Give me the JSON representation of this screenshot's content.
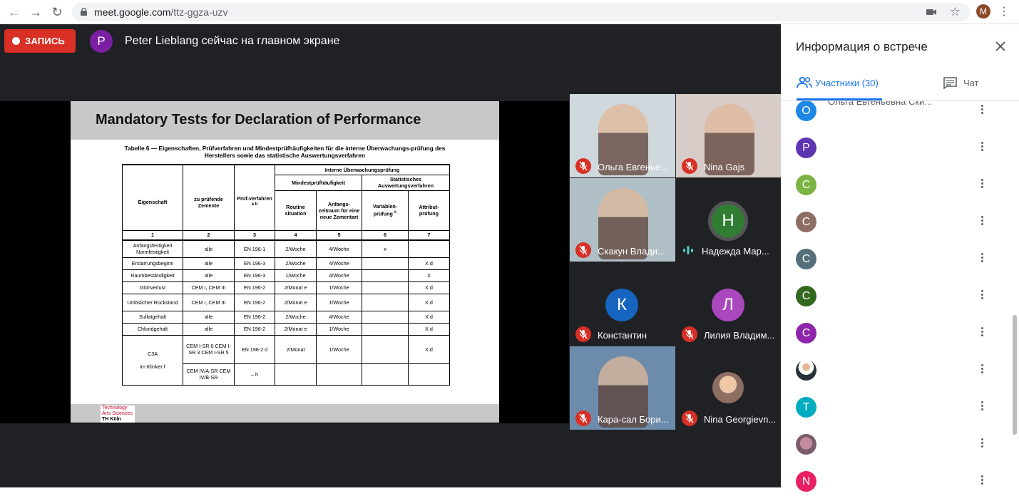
{
  "browser": {
    "url_host": "meet.google.com",
    "url_path": "/ttz-ggza-uzv",
    "profile_initial": "M"
  },
  "stage": {
    "record_label": "ЗАПИСЬ",
    "presenter_initial": "P",
    "presenter_text": "Peter Lieblang сейчас на главном экране"
  },
  "slide": {
    "title": "Mandatory Tests for Declaration of Performance",
    "caption": "Tabelle 6 — Eigenschaften, Prüfverfahren und Mindestprüfhäufigkeiten für die interne Überwachungs-prüfung des Herstellers sowie das statistische Auswertungsverfahren",
    "header_group": "Interne Überwachungsprüfung",
    "header_min": "Mindestprüfhäufigkeit",
    "header_stat": "Statistisches Auswertungsverfahren",
    "col_eigenschaft": "Eigenschaft",
    "col_zemente": "zu prüfende Zemente",
    "col_pruef": "Prüf-verfahren",
    "col_pruef_sup": "a b",
    "col_routine": "Routine situation",
    "col_anfangs": "Anfangs-zeitraum für eine neue Zementart",
    "col_variablen": "Variablen-prüfung",
    "col_variablen_sup": "c",
    "col_attribut": "Attribut-prüfung",
    "col_numbers": [
      "1",
      "2",
      "3",
      "4",
      "5",
      "6",
      "7"
    ],
    "rows": [
      [
        "Anfangsfestigkeit Normfestigkeit",
        "alle",
        "EN 196-1",
        "2/Woche",
        "4/Woche",
        "x",
        ""
      ],
      [
        "Erstarrungsbeginn",
        "alle",
        "EN 196-3",
        "2/Woche",
        "4/Woche",
        "",
        "X d"
      ],
      [
        "Raumbeständigkeit",
        "alle",
        "EN 196-3",
        "1/Woche",
        "4/Woche",
        "",
        "X"
      ],
      [
        "Glühverlust",
        "CEM I, CEM III",
        "EN 196-2",
        "2/Monat e",
        "1/Woche",
        "",
        "X d"
      ],
      [
        "Unlöslicher Rückstand",
        "CEM I, CEM III",
        "EN 196-2",
        "2/Monat e",
        "1/Woche",
        "",
        "X d"
      ],
      [
        "Sulfatgehalt",
        "alle",
        "EN 196-2",
        "2/Woche",
        "4/Woche",
        "",
        "X d"
      ],
      [
        "Chloridgehalt",
        "alle",
        "EN 196-2",
        "2/Monat e",
        "1/Woche",
        "",
        "X d"
      ]
    ],
    "c3a_label": "C3A",
    "c3a_sub": "im Klinker f",
    "c3a_zemente_a": "CEM I-SR 0 CEM I-SR 3 CEM I-SR 5",
    "c3a_pruef_a": "EN 196-2 d",
    "c3a_routine_a": "2/Monat",
    "c3a_anfangs_a": "1/Woche",
    "c3a_attr_a": "X d",
    "c3a_zemente_b": "CEM IV/A-SR CEM IV/B-SR",
    "c3a_pruef_b": "– h",
    "logo_line1": "Technology",
    "logo_line2": "Arts Sciences",
    "logo_line3": "TH Köln"
  },
  "tiles": [
    {
      "name": "Ольга Евгенье...",
      "muted": true
    },
    {
      "name": "Nina Gajs",
      "muted": true
    },
    {
      "name": "Скакун Влади...",
      "muted": true
    },
    {
      "name": "Надежда Мар...",
      "muted": false,
      "initial": "Н",
      "color": "#2e7d32"
    },
    {
      "name": "Константин",
      "muted": true,
      "initial": "К",
      "color": "#1565c0"
    },
    {
      "name": "Лилия Владим...",
      "muted": true,
      "initial": "Л",
      "color": "#ab47bc"
    },
    {
      "name": "Кара-сал Бори...",
      "muted": true
    },
    {
      "name": "Nina Georgievn...",
      "muted": true
    }
  ],
  "sidebar": {
    "title": "Информация о встрече",
    "tab_people": "Участники (30)",
    "tab_chat": "Чат",
    "participants": [
      {
        "initial": "О",
        "color": "#1e88e5",
        "name": "Ольга Евгеньевна Ски..."
      },
      {
        "initial": "P",
        "color": "#5e35b1",
        "name": ""
      },
      {
        "initial": "C",
        "color": "#7cb342",
        "name": ""
      },
      {
        "initial": "C",
        "color": "#8d6e63",
        "name": ""
      },
      {
        "initial": "C",
        "color": "#546e7a",
        "name": ""
      },
      {
        "initial": "C",
        "color": "#33691e",
        "name": ""
      },
      {
        "initial": "C",
        "color": "#8e24aa",
        "name": ""
      },
      {
        "initial": "",
        "color": "#eceff1",
        "name": "",
        "photo": true
      },
      {
        "initial": "T",
        "color": "#00acc1",
        "name": ""
      },
      {
        "initial": "",
        "color": "#9e7b8a",
        "name": "",
        "photo": true
      },
      {
        "initial": "N",
        "color": "#e91e63",
        "name": ""
      }
    ]
  },
  "colors": {
    "record_red": "#d93025",
    "meet_blue": "#1a73e8",
    "stage_bg": "#202124"
  }
}
